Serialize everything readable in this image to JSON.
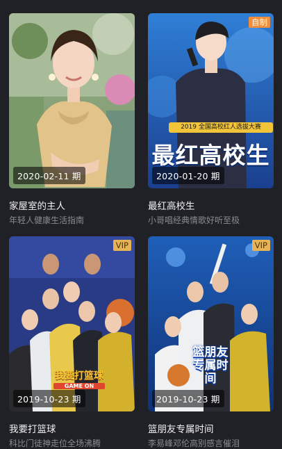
{
  "cards": [
    {
      "date": "2020-02-11 期",
      "title": "家屋室的主人",
      "subtitle": "年轻人健康生活指南",
      "badge": ""
    },
    {
      "date": "2020-01-20 期",
      "title": "最红高校生",
      "subtitle": "小哥唱经典情歌好听至极",
      "badge": "自制",
      "poster": {
        "banner": "2019 全国高校红人选拔大赛",
        "headline": "最红高校生"
      }
    },
    {
      "date": "2019-10-23 期",
      "title": "我要打篮球",
      "subtitle": "科比门徒神走位全场沸腾",
      "badge": "VIP",
      "poster": {
        "logo": "我要打篮球",
        "logo_sub": "GAME ON"
      }
    },
    {
      "date": "2019-10-23 期",
      "title": "篮朋友专属时间",
      "subtitle": "李易峰邓伦高别感言催泪",
      "badge": "VIP",
      "poster": {
        "logo": "篮朋友专属时间"
      }
    }
  ],
  "colors": {
    "background": "#202126",
    "badge_self": "#f08e3b",
    "badge_vip": "#e6b457"
  }
}
